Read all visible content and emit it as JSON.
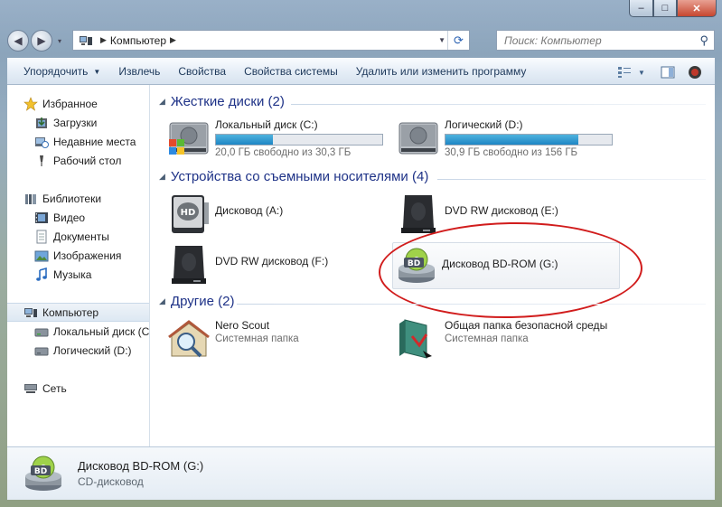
{
  "window": {
    "caption": {
      "minimize": "–",
      "maximize": "□",
      "close": "✕"
    }
  },
  "nav": {
    "back": "◀",
    "forward": "▶",
    "dropdown": "▾",
    "address": {
      "crumb": "Компьютер"
    },
    "search_placeholder": "Поиск: Компьютер"
  },
  "toolbar": {
    "organize": "Упорядочить",
    "eject": "Извлечь",
    "properties": "Свойства",
    "system_properties": "Свойства системы",
    "uninstall": "Удалить или изменить программу"
  },
  "sidebar": {
    "favorites": {
      "label": "Избранное",
      "items": [
        {
          "label": "Загрузки",
          "icon": "downloads-icon"
        },
        {
          "label": "Недавние места",
          "icon": "recent-places-icon"
        },
        {
          "label": "Рабочий стол",
          "icon": "desktop-icon"
        }
      ]
    },
    "libraries": {
      "label": "Библиотеки",
      "items": [
        {
          "label": "Видео",
          "icon": "video-icon"
        },
        {
          "label": "Документы",
          "icon": "documents-icon"
        },
        {
          "label": "Изображения",
          "icon": "images-icon"
        },
        {
          "label": "Музыка",
          "icon": "music-icon"
        }
      ]
    },
    "computer": {
      "label": "Компьютер",
      "items": [
        {
          "label": "Локальный диск (C",
          "icon": "local-disk-icon"
        },
        {
          "label": "Логический (D:)",
          "icon": "local-disk-icon"
        }
      ]
    },
    "network": {
      "label": "Сеть"
    }
  },
  "groups": {
    "hard_disks": {
      "title": "Жесткие диски (2)",
      "items": [
        {
          "name": "Локальный диск (C:)",
          "free": "20,0 ГБ свободно из 30,3 ГБ",
          "used_fraction": 0.34
        },
        {
          "name": "Логический (D:)",
          "free": "30,9 ГБ свободно из 156 ГБ",
          "used_fraction": 0.8
        }
      ]
    },
    "removable": {
      "title": "Устройства со съемными носителями (4)",
      "items": [
        {
          "name": "Дисковод (A:)"
        },
        {
          "name": "DVD RW дисковод (E:)"
        },
        {
          "name": "DVD RW дисковод (F:)"
        },
        {
          "name": "Дисковод BD-ROM (G:)"
        }
      ]
    },
    "other": {
      "title": "Другие (2)",
      "items": [
        {
          "name": "Nero Scout",
          "type": "Системная папка"
        },
        {
          "name": "Общая папка безопасной среды",
          "type": "Системная папка"
        }
      ]
    }
  },
  "details": {
    "name": "Дисковод BD-ROM (G:)",
    "type": "CD-дисковод",
    "badge": "BD"
  },
  "icon_labels": {
    "hd": "HD",
    "bd": "BD"
  },
  "colors": {
    "group_header": "#1e3287",
    "progress": "#1e86c4",
    "annotation": "#d11c1c"
  }
}
